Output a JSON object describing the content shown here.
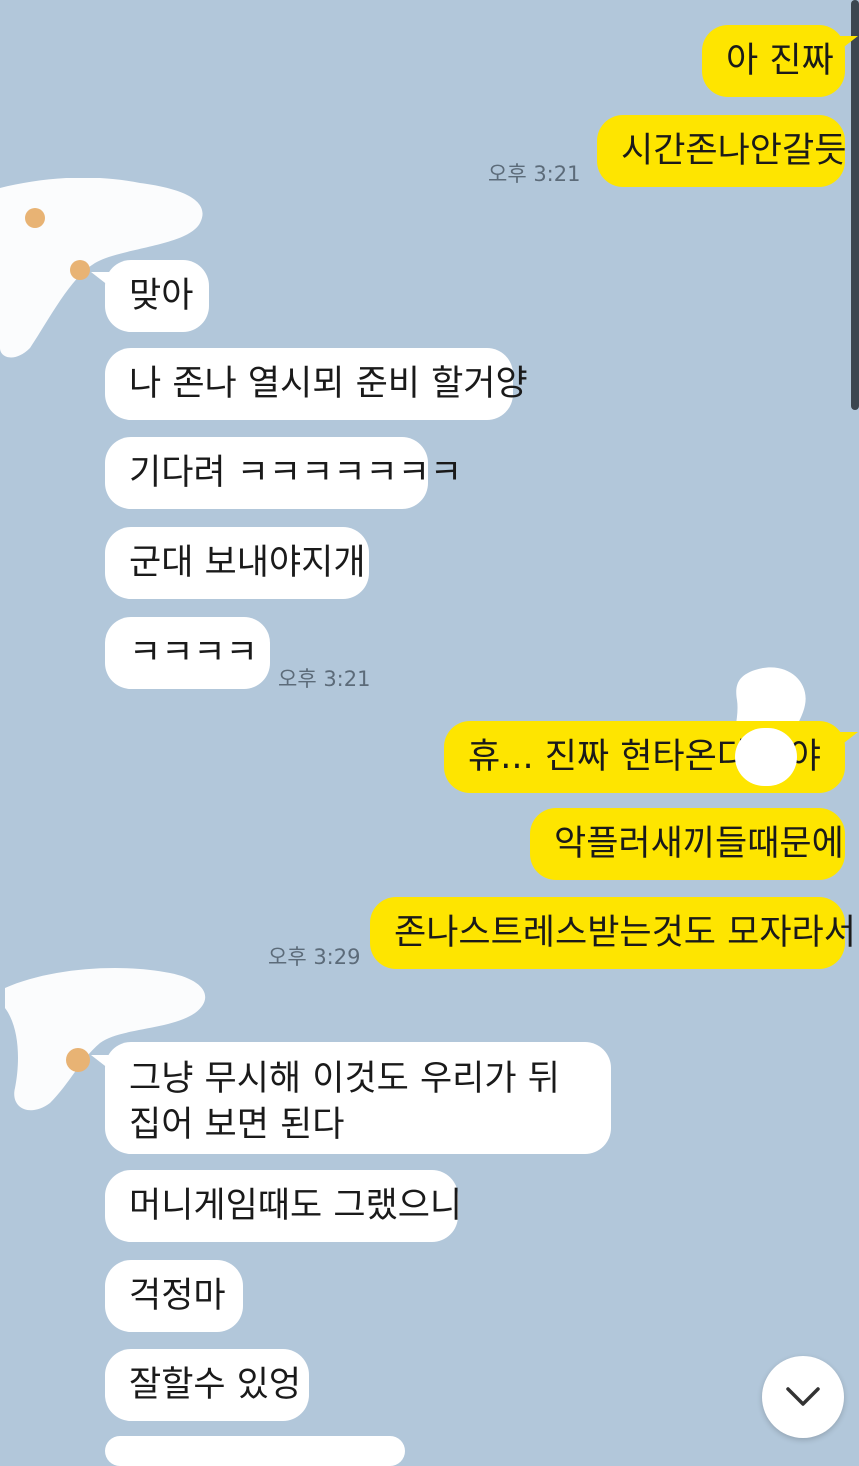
{
  "messages": [
    {
      "sender": "me",
      "text": "아 진짜"
    },
    {
      "sender": "me",
      "text": "시간존나안갈듯"
    },
    {
      "sender": "other",
      "text": "맞아"
    },
    {
      "sender": "other",
      "text": "나 존나 열시뫼 준비 할거양"
    },
    {
      "sender": "other",
      "text": "기다려 ㅋㅋㅋㅋㅋㅋㅋ"
    },
    {
      "sender": "other",
      "text": "군대 보내야지개"
    },
    {
      "sender": "other",
      "text": "ㅋㅋㅋㅋ"
    },
    {
      "sender": "me",
      "text": "휴... 진짜 현타온다",
      "text_end": "야"
    },
    {
      "sender": "me",
      "text": "악플러새끼들때문에"
    },
    {
      "sender": "me",
      "text": "존나스트레스받는것도 모자라서"
    },
    {
      "sender": "other",
      "text": "그냥 무시해 이것도 우리가 뒤집어 보면 된다"
    },
    {
      "sender": "other",
      "text": "머니게임때도 그랬으니"
    },
    {
      "sender": "other",
      "text": "걱정마"
    },
    {
      "sender": "other",
      "text": "잘할수 있엉"
    }
  ],
  "timestamps": {
    "t1": "오후 3:21",
    "t2": "오후 3:21",
    "t3": "오후 3:29"
  },
  "icons": {
    "scroll_down": "chevron-down-icon"
  },
  "colors": {
    "background": "#b2c7da",
    "my_bubble": "#fee500",
    "other_bubble": "#ffffff",
    "timestamp": "#5c6b79"
  }
}
